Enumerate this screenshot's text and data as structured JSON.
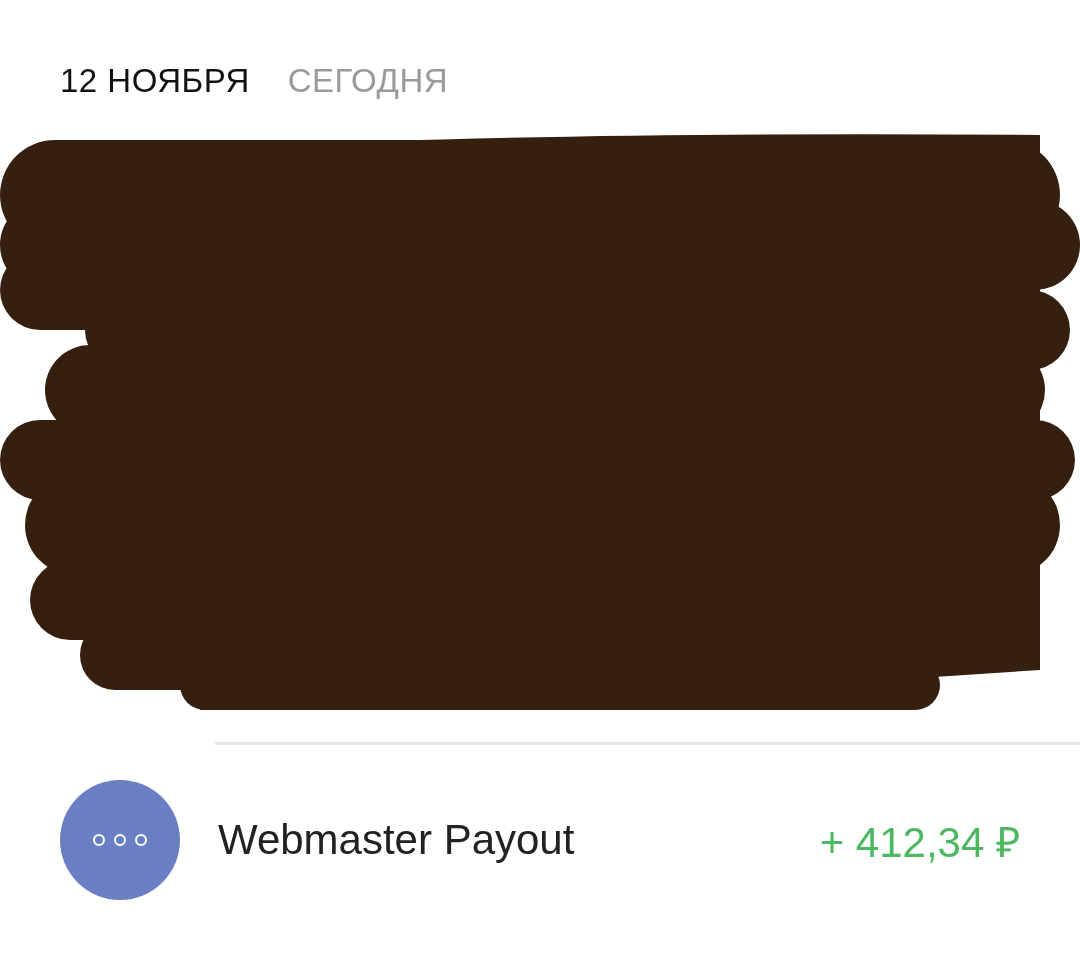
{
  "date_header": {
    "date": "12 НОЯБРЯ",
    "relative": "СЕГОДНЯ"
  },
  "redaction": true,
  "transactions": [
    {
      "title": "Webmaster Payout",
      "amount": "+ 412,34 ₽",
      "kind": "income"
    }
  ]
}
